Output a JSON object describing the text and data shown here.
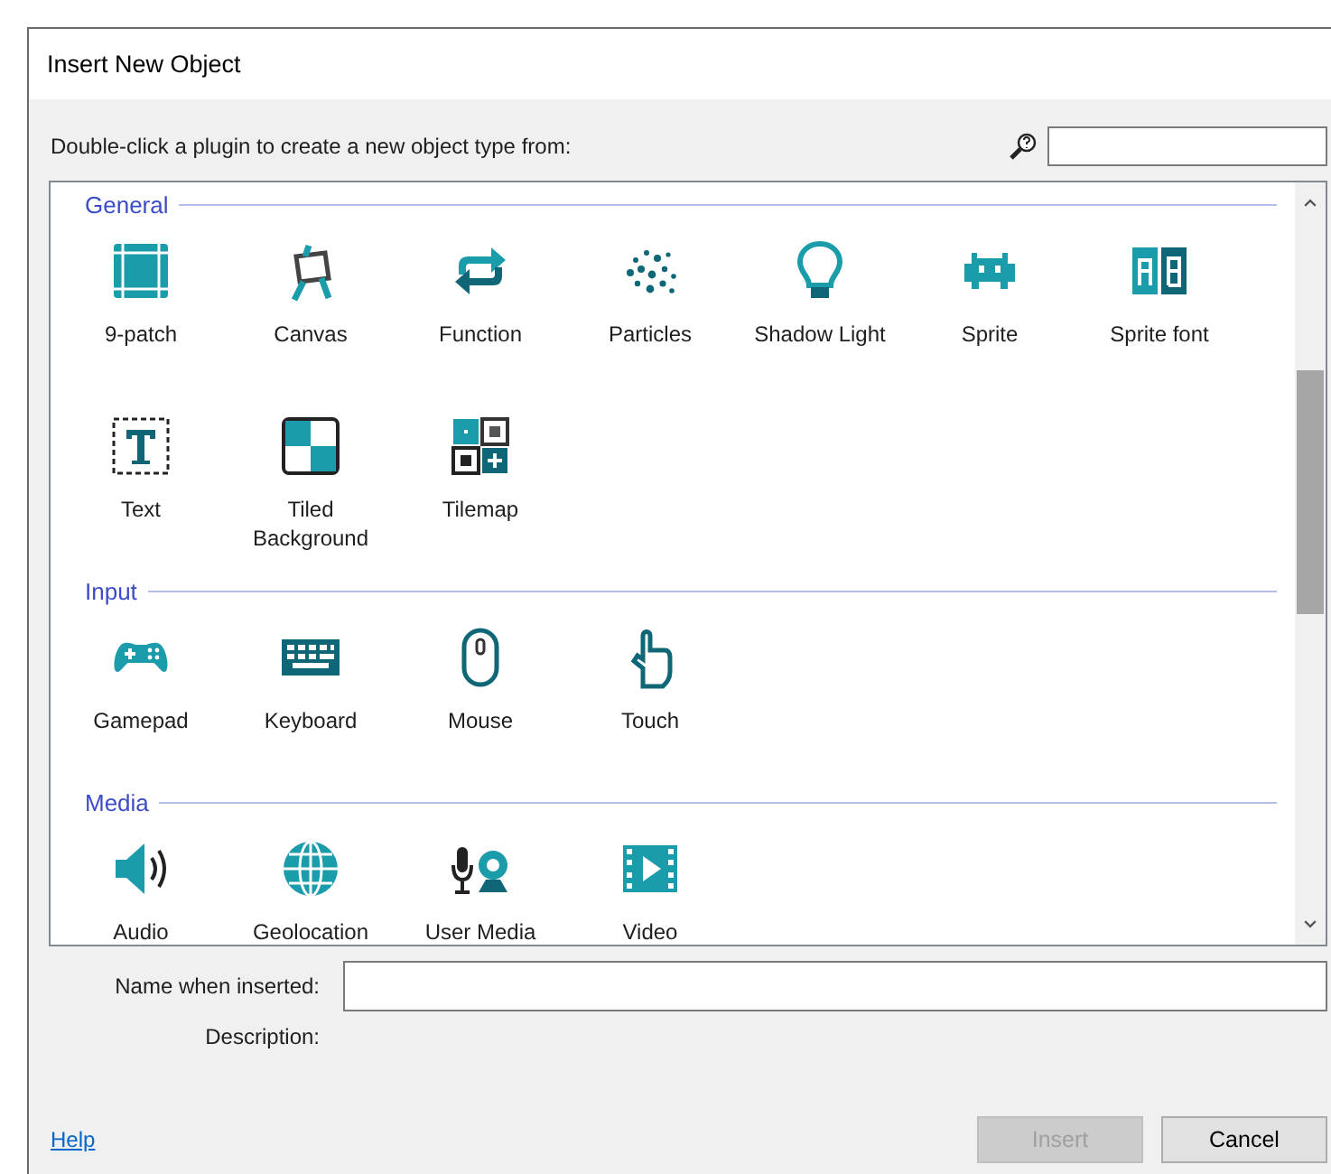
{
  "window": {
    "title": "Insert New Object"
  },
  "instruction": "Double-click a plugin to create a new object type from:",
  "sections": [
    {
      "title": "General",
      "items": [
        {
          "label": "9-patch"
        },
        {
          "label": "Canvas"
        },
        {
          "label": "Function"
        },
        {
          "label": "Particles"
        },
        {
          "label": "Shadow Light"
        },
        {
          "label": "Sprite"
        },
        {
          "label": "Sprite font"
        },
        {
          "label": "Text"
        },
        {
          "label": "Tiled Background"
        },
        {
          "label": "Tilemap"
        }
      ]
    },
    {
      "title": "Input",
      "items": [
        {
          "label": "Gamepad"
        },
        {
          "label": "Keyboard"
        },
        {
          "label": "Mouse"
        },
        {
          "label": "Touch"
        }
      ]
    },
    {
      "title": "Media",
      "items": [
        {
          "label": "Audio"
        },
        {
          "label": "Geolocation"
        },
        {
          "label": "User Media"
        },
        {
          "label": "Video"
        }
      ]
    }
  ],
  "name_field": {
    "label": "Name when inserted:"
  },
  "description": {
    "label": "Description:"
  },
  "help_link": "Help",
  "buttons": [
    {
      "label": "Insert",
      "disabled": true
    },
    {
      "label": "Cancel",
      "disabled": false
    }
  ]
}
